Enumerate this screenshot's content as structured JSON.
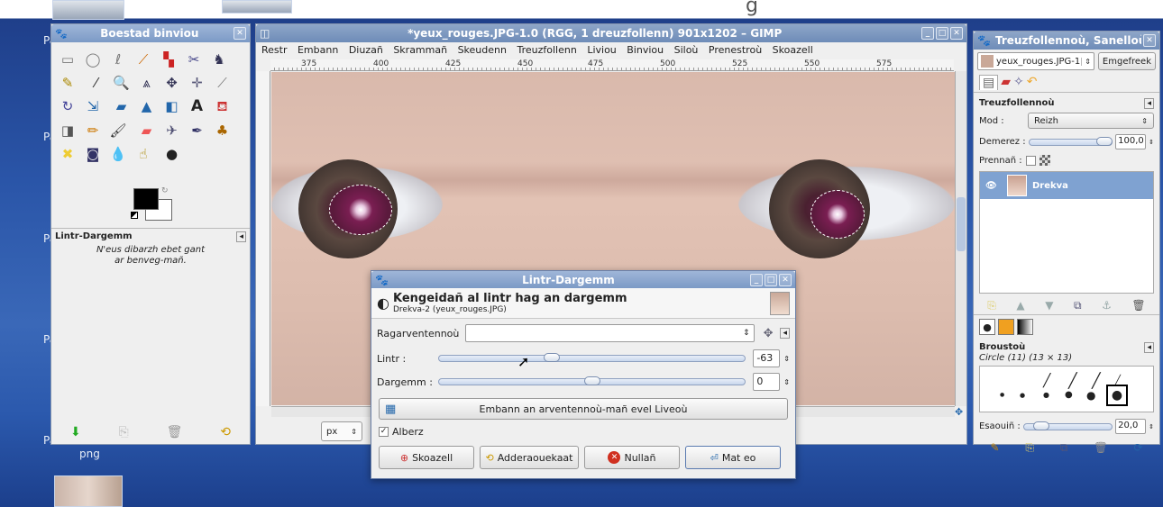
{
  "top_banner": {
    "text": "g"
  },
  "desktop": {
    "labels": [
      "Pa",
      "Pa",
      "Pa",
      "Pa",
      "Pa"
    ],
    "thumb_label": "png"
  },
  "toolbox": {
    "title": "Boestad binviou",
    "sub_panel_title": "Lintr-Dargemm",
    "sub_panel_message": "N'eus dibarzh ebet gant ar benveg-mañ."
  },
  "main_window": {
    "title": "*yeux_rouges.JPG-1.0 (RGG, 1 dreuzfollenn) 901x1202 – GIMP",
    "menu": [
      "Restr",
      "Embann",
      "Diuzañ",
      "Skrammañ",
      "Skeudenn",
      "Treuzfollenn",
      "Liviou",
      "Binviou",
      "Siloù",
      "Prenestroù",
      "Skoazell"
    ],
    "ruler_ticks": [
      "375",
      "400",
      "425",
      "450",
      "475",
      "500",
      "525",
      "550",
      "575"
    ],
    "unit": "px"
  },
  "dialog": {
    "title": "Lintr-Dargemm",
    "heading": "Kengeidañ al lintr hag an dargemm",
    "subheading": "Drekva-2 (yeux_rouges.JPG)",
    "presets_label": "Ragarventennoù",
    "brightness_label": "Lintr :",
    "brightness_value": "-63",
    "brightness_fraction": 0.37,
    "contrast_label": "Dargemm :",
    "contrast_value": "0",
    "contrast_fraction": 0.5,
    "levels_button": "Embann an arventennoù-mañ evel Liveoù",
    "preview_label": "Alberz",
    "preview_checked": true,
    "buttons": {
      "help": "Skoazell",
      "reset": "Adderaouekaat",
      "cancel": "Nullañ",
      "ok": "Mat eo"
    }
  },
  "layers_panel": {
    "title": "Treuzfollennoù, Sanelloù, ...",
    "image_select": "yeux_rouges.JPG-1",
    "auto_button": "Emgefreek",
    "section_title": "Treuzfollennoù",
    "mode_label": "Mod :",
    "mode_value": "Reizh",
    "opacity_label": "Demerez :",
    "opacity_value": "100,0",
    "lock_label": "Prennañ :",
    "layer_name": "Drekva",
    "brushes_title": "Broustoù",
    "brush_info": "Circle (11) (13 × 13)",
    "spacing_label": "Esaouiñ :",
    "spacing_value": "20,0",
    "spacing_fraction": 0.2
  },
  "colors": {
    "accent": "#7fa2d1",
    "title": "#7c9ac6",
    "cancel_red": "#d03020"
  }
}
